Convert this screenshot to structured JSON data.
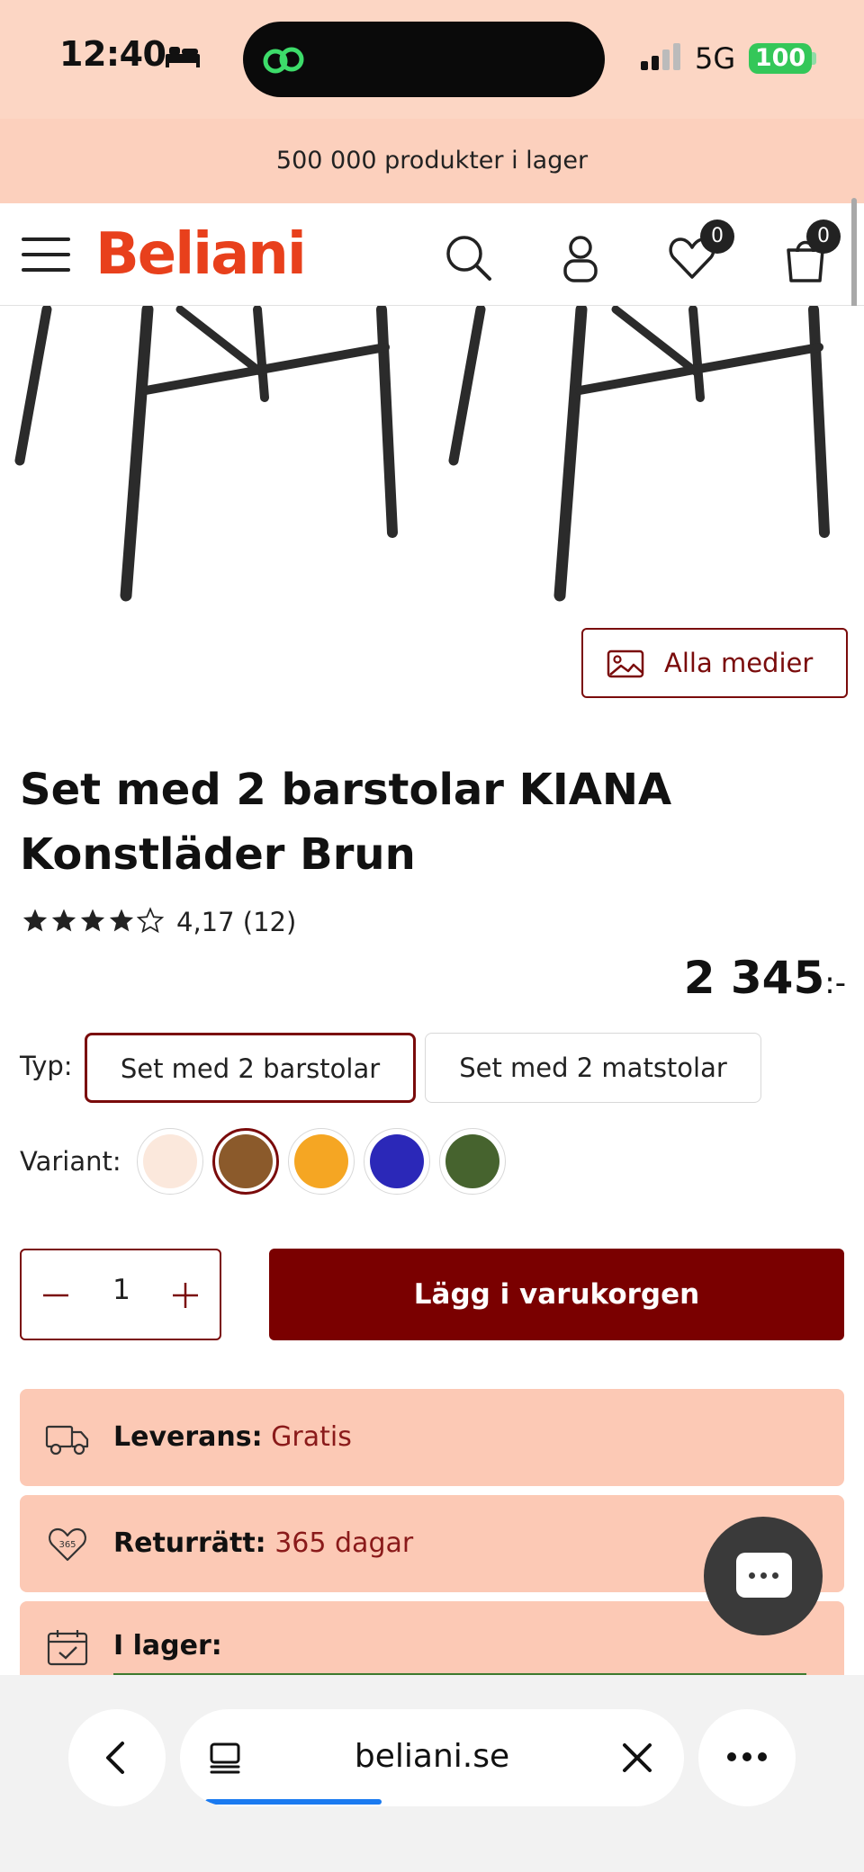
{
  "status": {
    "time": "12:40",
    "network": "5G",
    "battery": "100"
  },
  "promo": {
    "text": "500 000 produkter i lager"
  },
  "header": {
    "logo": "Beliani",
    "wishlist_count": "0",
    "cart_count": "0"
  },
  "gallery": {
    "all_media_label": "Alla medier"
  },
  "product": {
    "title": "Set med 2 barstolar KIANA Konstläder Brun",
    "rating": 4.17,
    "rating_text": "4,17 (12)",
    "price": "2 345",
    "price_suffix": ":-"
  },
  "type": {
    "label": "Typ:",
    "options": [
      {
        "label": "Set med 2 barstolar",
        "selected": true
      },
      {
        "label": "Set med 2 matstolar",
        "selected": false
      }
    ]
  },
  "variant": {
    "label": "Variant:",
    "swatches": [
      {
        "color": "#fbe8dc",
        "selected": false
      },
      {
        "color": "#8b5a2b",
        "selected": true
      },
      {
        "color": "#f5a623",
        "selected": false
      },
      {
        "color": "#2b28b8",
        "selected": false
      },
      {
        "color": "#46632e",
        "selected": false
      }
    ]
  },
  "quantity": {
    "value": "1"
  },
  "cart": {
    "add_label": "Lägg i varukorgen"
  },
  "info": [
    {
      "label": "Leverans:",
      "value": "Gratis",
      "icon": "truck-icon"
    },
    {
      "label": "Returrätt:",
      "value": "365 dagar",
      "icon": "return-365-icon"
    },
    {
      "label": "I lager:",
      "value": "",
      "icon": "calendar-check-icon"
    }
  ],
  "browser": {
    "url": "beliani.se",
    "load_progress": 0.35
  },
  "colors": {
    "brand": "#e8401c",
    "accent": "#7a0000",
    "info_bg": "#fcc9b5",
    "promo_bg": "#fcd0bd"
  }
}
